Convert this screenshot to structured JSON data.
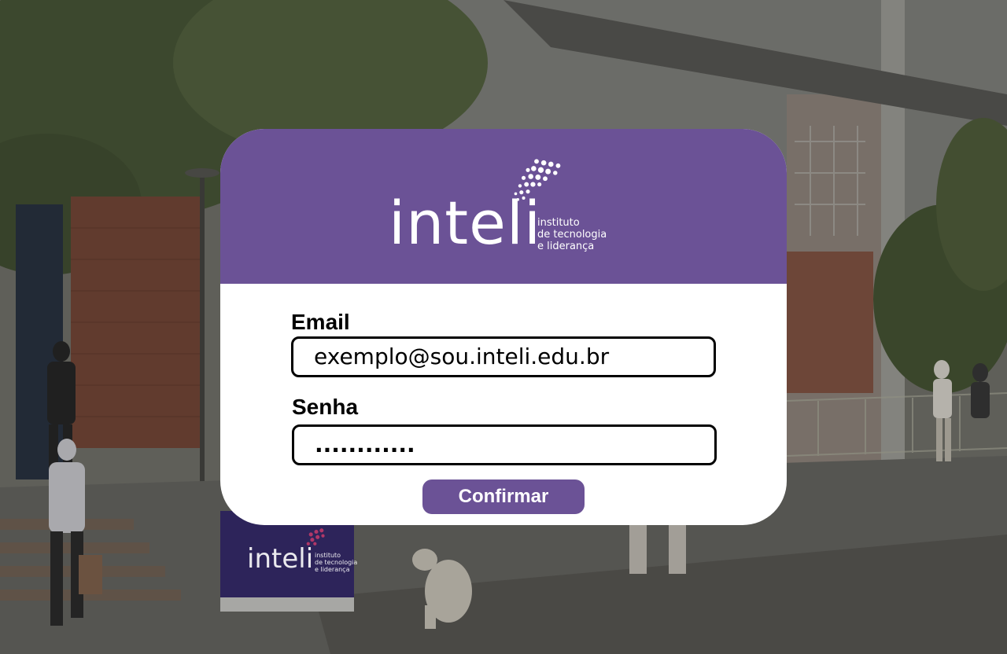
{
  "logo": {
    "wordmark": "inteli",
    "tagline": [
      "instituto",
      "de tecnologia",
      "e liderança"
    ]
  },
  "form": {
    "email_label": "Email",
    "email_value": "exemplo@sou.inteli.edu.br",
    "password_label": "Senha",
    "password_value": "............",
    "submit_label": "Confirmar"
  },
  "background_sign": {
    "wordmark": "inteli",
    "tagline": [
      "instituto",
      "de tecnologia",
      "e liderança"
    ]
  },
  "colors": {
    "brand_purple": "#6b5296",
    "card_background": "#ffffff",
    "input_border": "#000000"
  },
  "icons": [
    "inteli-dots-logo-icon"
  ]
}
